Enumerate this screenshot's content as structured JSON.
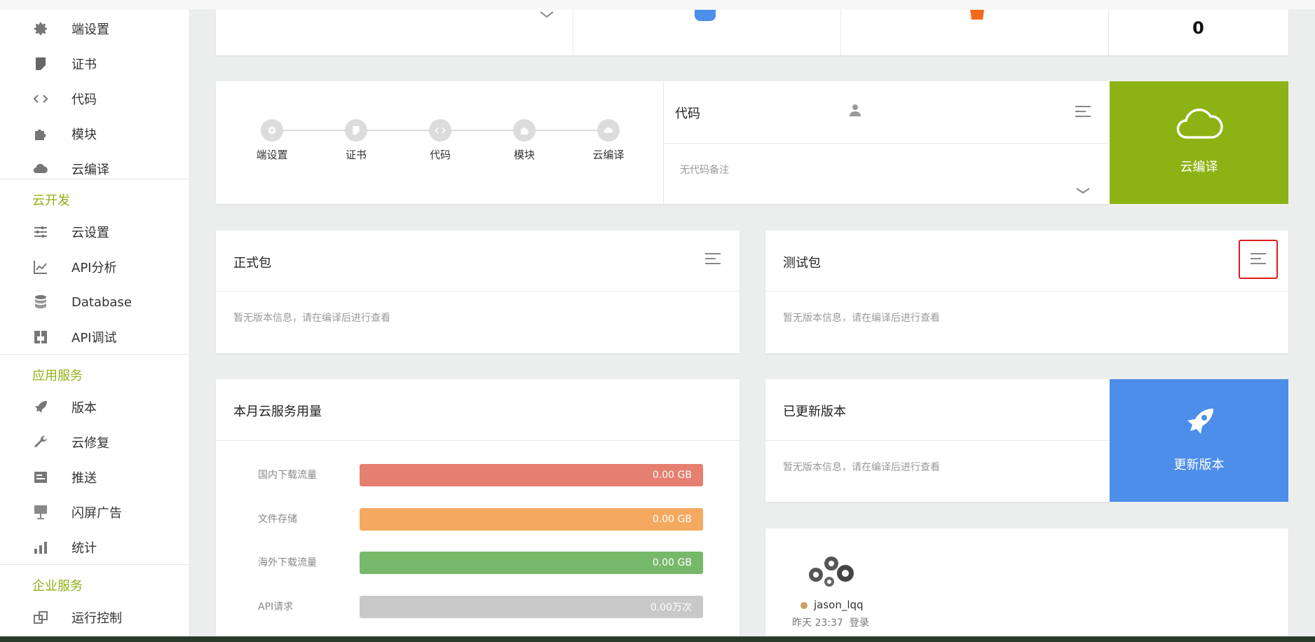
{
  "sidebar": {
    "top_items": [
      {
        "label": "端设置",
        "icon": "gear-icon"
      },
      {
        "label": "证书",
        "icon": "certificate-icon"
      },
      {
        "label": "代码",
        "icon": "code-icon"
      },
      {
        "label": "模块",
        "icon": "puzzle-icon"
      },
      {
        "label": "云编译",
        "icon": "cloud-icon"
      }
    ],
    "sections": [
      {
        "title": "云开发",
        "items": [
          {
            "label": "云设置",
            "icon": "sliders-icon"
          },
          {
            "label": "API分析",
            "icon": "line-chart-icon"
          },
          {
            "label": "Database",
            "icon": "database-icon"
          },
          {
            "label": "API调试",
            "icon": "debug-icon"
          }
        ]
      },
      {
        "title": "应用服务",
        "items": [
          {
            "label": "版本",
            "icon": "rocket-icon"
          },
          {
            "label": "云修复",
            "icon": "wrench-icon"
          },
          {
            "label": "推送",
            "icon": "push-icon"
          },
          {
            "label": "闪屏广告",
            "icon": "ad-icon"
          },
          {
            "label": "统计",
            "icon": "bar-chart-icon"
          }
        ]
      },
      {
        "title": "企业服务",
        "items": [
          {
            "label": "运行控制",
            "icon": "window-control-icon"
          }
        ]
      }
    ]
  },
  "top_row": {
    "count_value": "0"
  },
  "steps": [
    "端设置",
    "证书",
    "代码",
    "模块",
    "云编译"
  ],
  "code_card": {
    "title": "代码",
    "note": "无代码备注"
  },
  "cloud_compile": {
    "label": "云编译",
    "color": "#8db214"
  },
  "release_card": {
    "title": "正式包",
    "message": "暂无版本信息，请在编译后进行查看"
  },
  "test_card": {
    "title": "测试包",
    "message": "暂无版本信息，请在编译后进行查看"
  },
  "usage_card": {
    "title": "本月云服务用量",
    "rows": [
      {
        "label": "国内下载流量",
        "value": "0.00 GB",
        "color": "#e57f6f"
      },
      {
        "label": "文件存储",
        "value": "0.00 GB",
        "color": "#f5a85f"
      },
      {
        "label": "海外下载流量",
        "value": "0.00 GB",
        "color": "#77b96a"
      },
      {
        "label": "API请求",
        "value": "0.00万次",
        "color": "#c8c8c8"
      }
    ]
  },
  "updated_card": {
    "title": "已更新版本",
    "message": "暂无版本信息，请在编译后进行查看"
  },
  "update_button": {
    "label": "更新版本",
    "color": "#4c8ee9"
  },
  "activity": {
    "user": "jason_lqq",
    "time": "昨天 23:37",
    "action": "登录"
  }
}
